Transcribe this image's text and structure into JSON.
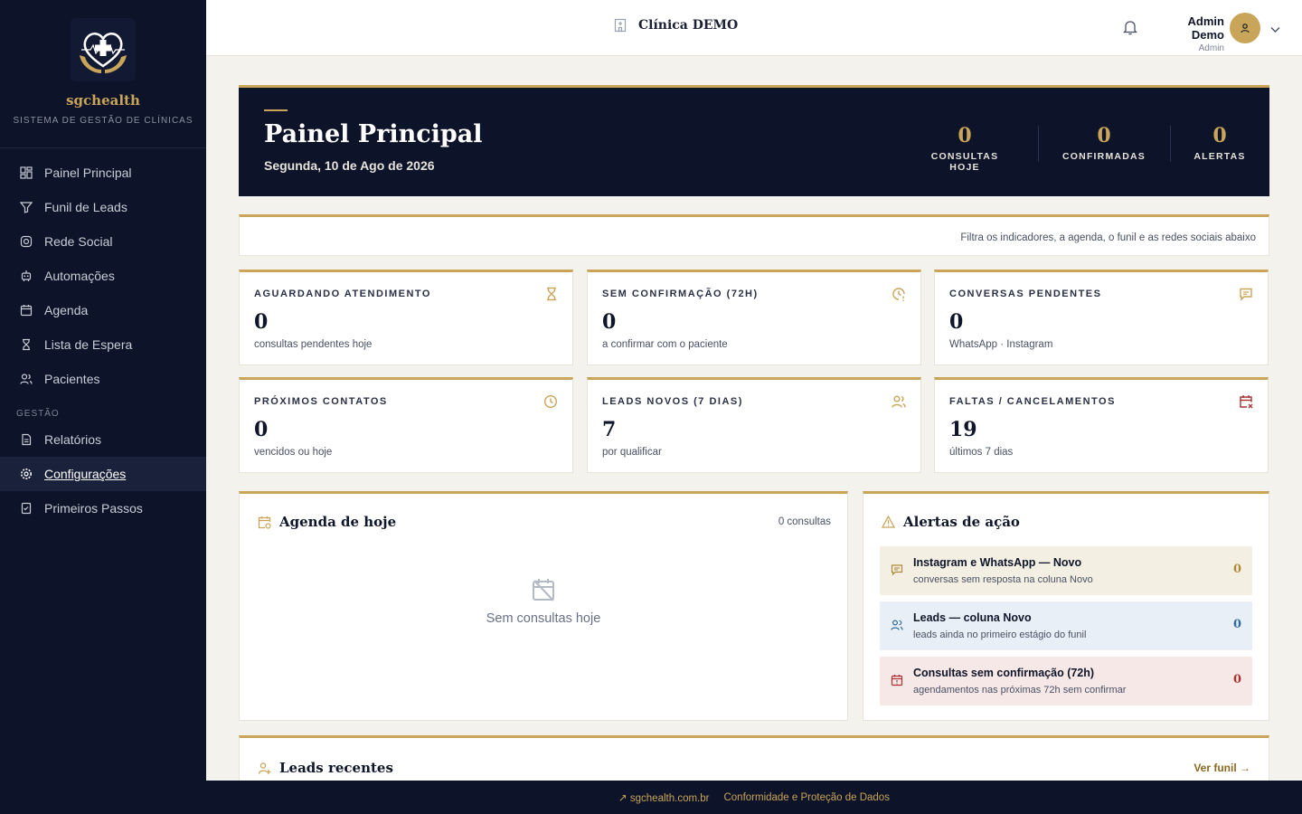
{
  "brand": {
    "name": "sgchealth",
    "subtitle": "SISTEMA DE GESTÃO DE CLÍNICAS"
  },
  "nav": {
    "items": [
      {
        "label": "Painel Principal",
        "icon": "dashboard-icon"
      },
      {
        "label": "Funil de Leads",
        "icon": "funnel-icon"
      },
      {
        "label": "Rede Social",
        "icon": "instagram-icon"
      },
      {
        "label": "Automações",
        "icon": "robot-icon"
      },
      {
        "label": "Agenda",
        "icon": "calendar-icon"
      },
      {
        "label": "Lista de Espera",
        "icon": "hourglass-icon"
      },
      {
        "label": "Pacientes",
        "icon": "users-icon"
      }
    ],
    "section_label": "GESTÃO",
    "section_items": [
      {
        "label": "Relatórios",
        "icon": "report-icon"
      },
      {
        "label": "Configurações",
        "icon": "gear-icon",
        "active": true
      },
      {
        "label": "Primeiros Passos",
        "icon": "checklist-icon"
      }
    ]
  },
  "header": {
    "clinic": "Clínica DEMO",
    "user_name": "Admin Demo",
    "user_role": "Admin"
  },
  "hero": {
    "title": "Painel Principal",
    "date": "Segunda, 10 de Ago de 2026",
    "stats": [
      {
        "value": "0",
        "label": "CONSULTAS HOJE"
      },
      {
        "value": "0",
        "label": "CONFIRMADAS"
      },
      {
        "value": "0",
        "label": "ALERTAS"
      }
    ]
  },
  "filter": {
    "hint": "Filtra os indicadores, a agenda, o funil e as redes sociais abaixo"
  },
  "cards": [
    {
      "title": "AGUARDANDO ATENDIMENTO",
      "value": "0",
      "sub": "consultas pendentes hoje",
      "icon": "hourglass-icon"
    },
    {
      "title": "SEM CONFIRMAÇÃO (72H)",
      "value": "0",
      "sub": "a confirmar com o paciente",
      "icon": "clock-alert-icon"
    },
    {
      "title": "CONVERSAS PENDENTES",
      "value": "0",
      "sub": "WhatsApp · Instagram",
      "icon": "chat-icon"
    },
    {
      "title": "PRÓXIMOS CONTATOS",
      "value": "0",
      "sub": "vencidos ou hoje",
      "icon": "clock-icon"
    },
    {
      "title": "LEADS NOVOS (7 DIAS)",
      "value": "7",
      "sub": "por qualificar",
      "icon": "users-icon"
    },
    {
      "title": "FALTAS / CANCELAMENTOS",
      "value": "19",
      "sub": "últimos 7 dias",
      "icon": "calendar-x-icon"
    }
  ],
  "agenda": {
    "title": "Agenda de hoje",
    "count": "0 consultas",
    "empty": "Sem consultas hoje"
  },
  "alerts": {
    "title": "Alertas de ação",
    "items": [
      {
        "title": "Instagram e WhatsApp — Novo",
        "sub": "conversas sem resposta na coluna Novo",
        "value": "0",
        "bg": "#f3efe3",
        "color": "#b08a3a"
      },
      {
        "title": "Leads — coluna Novo",
        "sub": "leads ainda no primeiro estágio do funil",
        "value": "0",
        "bg": "#e9eff6",
        "color": "#2f6aa0"
      },
      {
        "title": "Consultas sem confirmação (72h)",
        "sub": "agendamentos nas próximas 72h sem confirmar",
        "value": "0",
        "bg": "#f6e8e7",
        "color": "#a83232"
      }
    ]
  },
  "leads": {
    "title": "Leads recentes",
    "link": "Ver funil →"
  },
  "footer": {
    "site": "sgchealth.com.br",
    "privacy": "Conformidade e Proteção de Dados"
  },
  "colors": {
    "navy": "#0d1328",
    "gold": "#c9a55a",
    "bg": "#f4f2ec"
  }
}
